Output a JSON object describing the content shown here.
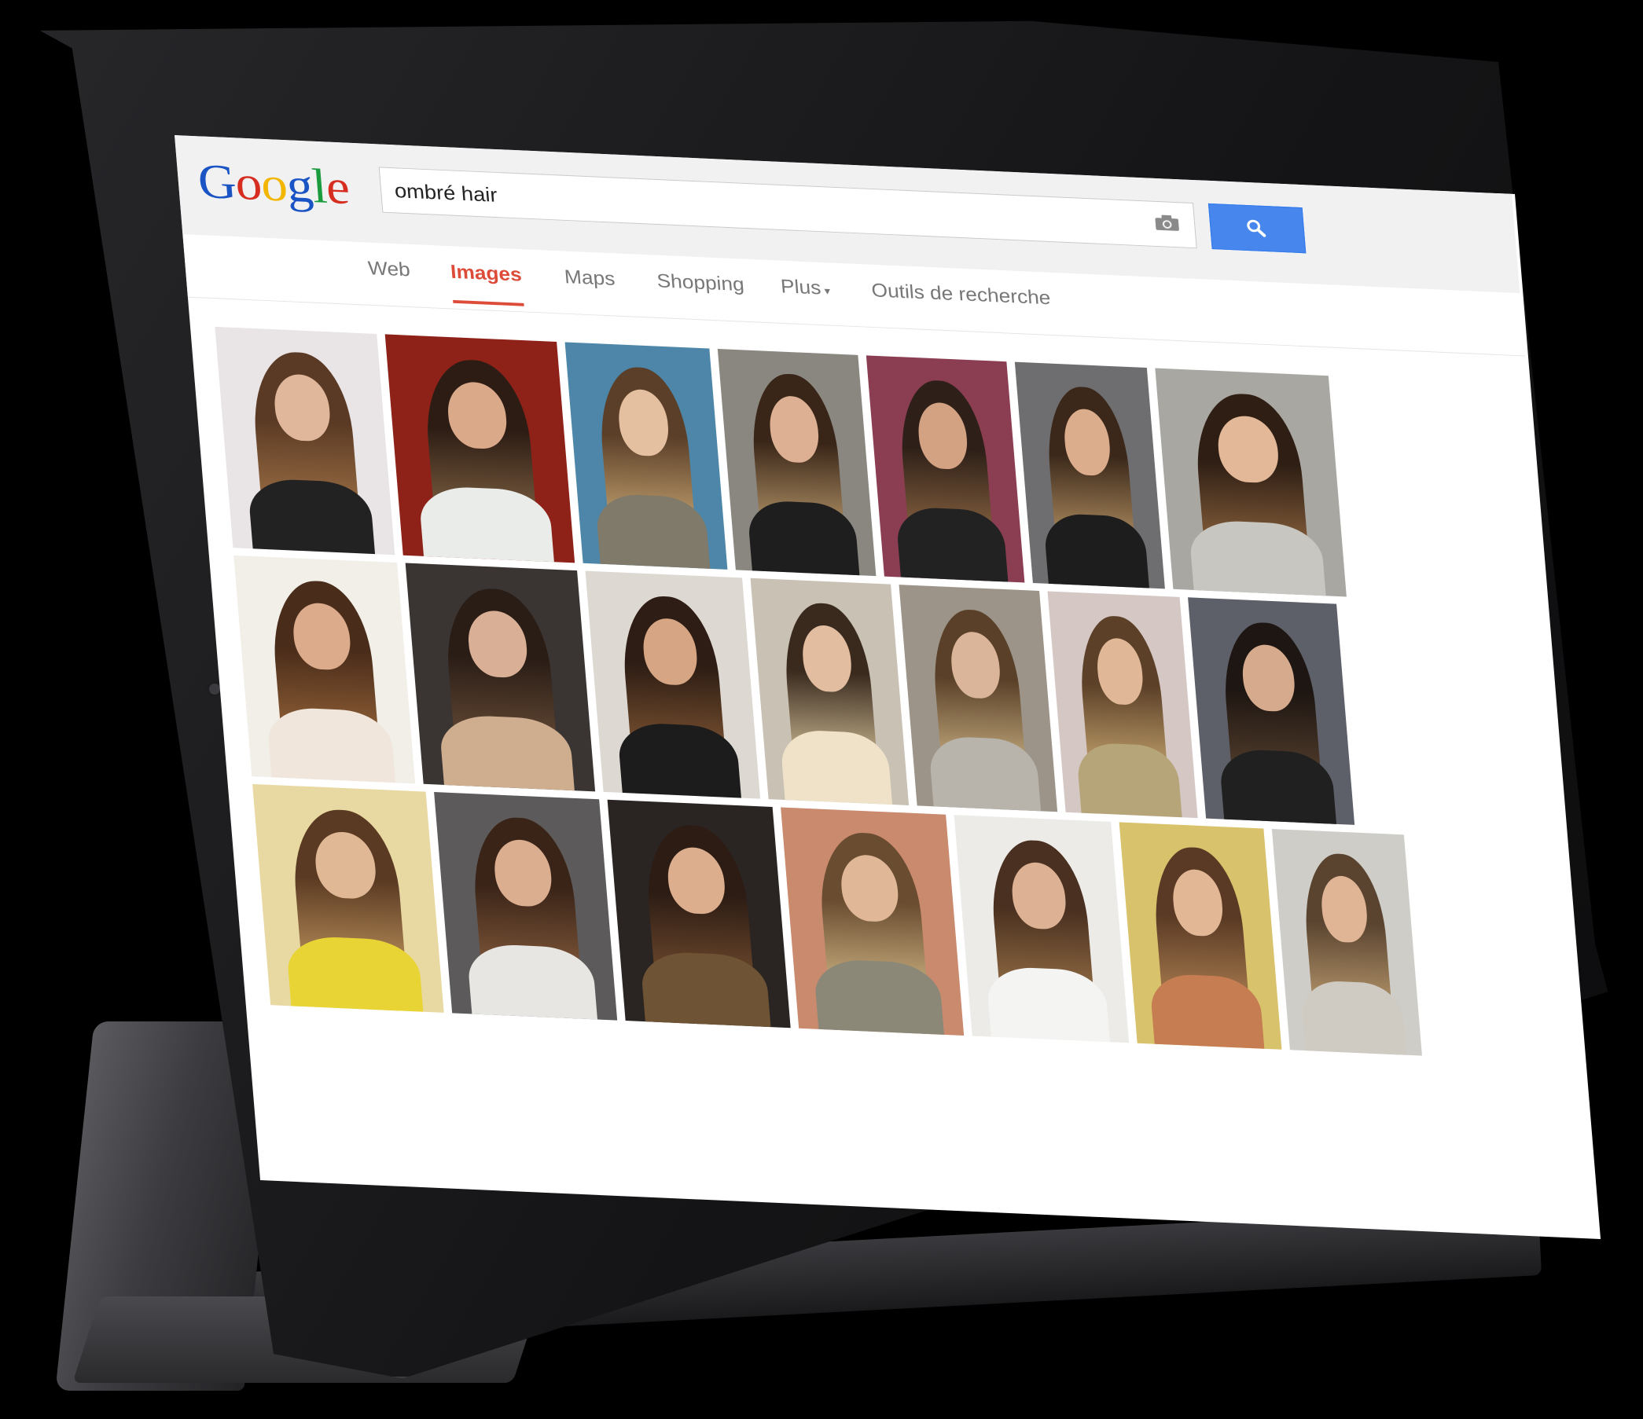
{
  "search": {
    "query": "ombré hair"
  },
  "logo": {
    "letters": [
      "G",
      "o",
      "o",
      "g",
      "l",
      "e"
    ],
    "colors": [
      "#1a53c4",
      "#d62d20",
      "#f2b600",
      "#1a53c4",
      "#1a9c3e",
      "#d62d20"
    ]
  },
  "tabs": [
    {
      "label": "Web",
      "active": false
    },
    {
      "label": "Images",
      "active": true
    },
    {
      "label": "Maps",
      "active": false
    },
    {
      "label": "Shopping",
      "active": false
    },
    {
      "label": "Plus",
      "active": false,
      "dropdown": true
    },
    {
      "label": "Outils de recherche",
      "active": false
    }
  ],
  "colors": {
    "accent": "#dd4b39",
    "search_button": "#4787ed",
    "tab_text": "#777777"
  },
  "icons": {
    "camera": "camera-icon",
    "search": "search-icon",
    "caret": "chevron-down-icon"
  },
  "results": {
    "rows": [
      [
        {
          "bg": "#e9e4e6",
          "hair": "#5a3a24",
          "tip": "#a7774a",
          "skin": "#e0b79b",
          "cloth": "#222222"
        },
        {
          "bg": "#8e2218",
          "hair": "#2c1c14",
          "tip": "#8a6a48",
          "skin": "#d9a98a",
          "cloth": "#e9ece8"
        },
        {
          "bg": "#4d86a8",
          "hair": "#5b3f28",
          "tip": "#d2b07a",
          "skin": "#e4bfa0",
          "cloth": "#7f7a6a"
        },
        {
          "bg": "#8a8680",
          "hair": "#3a2618",
          "tip": "#c9a877",
          "skin": "#ddb093",
          "cloth": "#1e1e1e"
        },
        {
          "bg": "#8b3d52",
          "hair": "#2e2018",
          "tip": "#9a7048",
          "skin": "#d3a283",
          "cloth": "#222222"
        },
        {
          "bg": "#6e6e70",
          "hair": "#3b281a",
          "tip": "#c6a16e",
          "skin": "#dcad8d",
          "cloth": "#1d1d1d"
        },
        {
          "bg": "#a9a7a2",
          "hair": "#2e1e14",
          "tip": "#9b6e44",
          "skin": "#e2b898",
          "cloth": "#c8c6c0"
        }
      ],
      [
        {
          "bg": "#f1efe8",
          "hair": "#4a2c1a",
          "tip": "#9e6a3c",
          "skin": "#dbab8b",
          "cloth": "#f0e6dc"
        },
        {
          "bg": "#3a3432",
          "hair": "#2a1d16",
          "tip": "#6e513a",
          "skin": "#d9b096",
          "cloth": "#cfae90"
        },
        {
          "bg": "#ddd9d2",
          "hair": "#2d1d14",
          "tip": "#8a5c36",
          "skin": "#d5a584",
          "cloth": "#1c1c1c"
        },
        {
          "bg": "#c9c1b4",
          "hair": "#3a2a1e",
          "tip": "#e2cfa4",
          "skin": "#e2bda0",
          "cloth": "#efe2c8"
        },
        {
          "bg": "#9c9488",
          "hair": "#5a4028",
          "tip": "#d7bf8e",
          "skin": "#dab59a",
          "cloth": "#b8b4ac"
        },
        {
          "bg": "#d5c7c4",
          "hair": "#5c4028",
          "tip": "#d6b57a",
          "skin": "#e0b897",
          "cloth": "#b7a57a"
        },
        {
          "bg": "#5d6068",
          "hair": "#1e1612",
          "tip": "#5e4632",
          "skin": "#d6aa8c",
          "cloth": "#202020"
        }
      ],
      [
        {
          "bg": "#e8d9a2",
          "hair": "#5a3a22",
          "tip": "#c69a62",
          "skin": "#e1b896",
          "cloth": "#e9d436"
        },
        {
          "bg": "#5c5a5a",
          "hair": "#3a2418",
          "tip": "#8e6240",
          "skin": "#dcae90",
          "cloth": "#e8e6e2"
        },
        {
          "bg": "#2a2422",
          "hair": "#2c1c14",
          "tip": "#7c5232",
          "skin": "#dcae8e",
          "cloth": "#6e5434"
        },
        {
          "bg": "#c98a6e",
          "hair": "#6a4c30",
          "tip": "#dbc28e",
          "skin": "#e0b898",
          "cloth": "#8b8878"
        },
        {
          "bg": "#ecebe8",
          "hair": "#4a3020",
          "tip": "#a27a4c",
          "skin": "#dcb194",
          "cloth": "#f4f4f2"
        },
        {
          "bg": "#d9c26c",
          "hair": "#5a3a24",
          "tip": "#b98a58",
          "skin": "#e2b796",
          "cloth": "#c77d52"
        },
        {
          "bg": "#cfcdc8",
          "hair": "#5a4430",
          "tip": "#caa878",
          "skin": "#dfb596",
          "cloth": "#cfcac2"
        }
      ]
    ]
  }
}
